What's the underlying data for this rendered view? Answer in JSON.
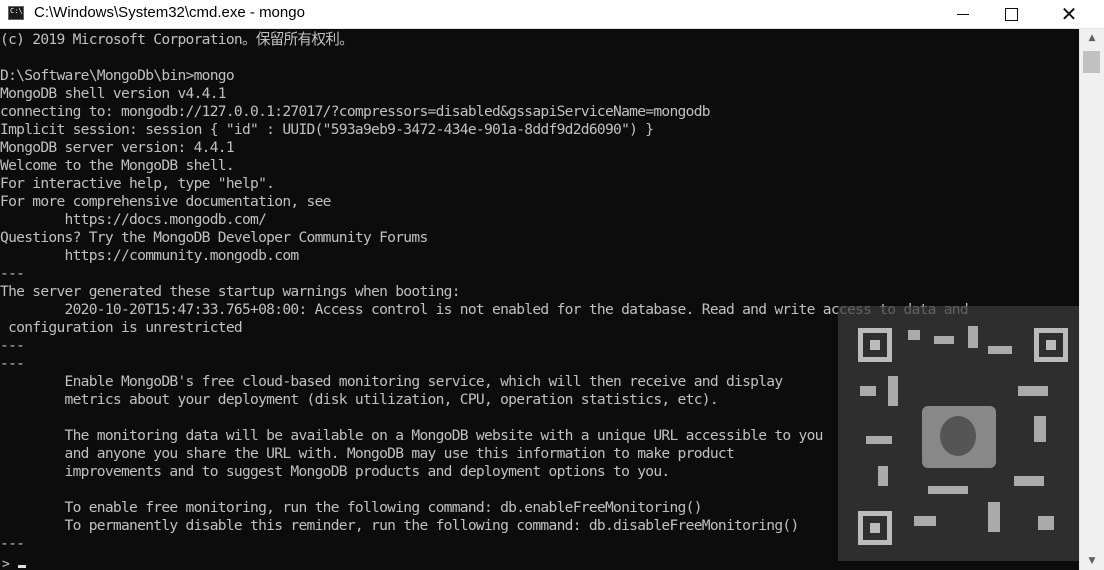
{
  "window": {
    "title": "C:\\Windows\\System32\\cmd.exe - mongo",
    "icons": {
      "app": "cmd-icon",
      "minimize": "minimize-icon",
      "maximize": "maximize-icon",
      "close": "close-icon"
    },
    "close_glyph": "✕"
  },
  "console": {
    "lines": [
      "(c) 2019 Microsoft Corporation。保留所有权利。",
      "",
      "D:\\Software\\MongoDb\\bin>mongo",
      "MongoDB shell version v4.4.1",
      "connecting to: mongodb://127.0.0.1:27017/?compressors=disabled&gssapiServiceName=mongodb",
      "Implicit session: session { \"id\" : UUID(\"593a9eb9-3472-434e-901a-8ddf9d2d6090\") }",
      "MongoDB server version: 4.4.1",
      "Welcome to the MongoDB shell.",
      "For interactive help, type \"help\".",
      "For more comprehensive documentation, see",
      "        https://docs.mongodb.com/",
      "Questions? Try the MongoDB Developer Community Forums",
      "        https://community.mongodb.com",
      "---",
      "The server generated these startup warnings when booting:",
      "        2020-10-20T15:47:33.765+08:00: Access control is not enabled for the database. Read and write access to data and",
      " configuration is unrestricted",
      "---",
      "---",
      "        Enable MongoDB's free cloud-based monitoring service, which will then receive and display",
      "        metrics about your deployment (disk utilization, CPU, operation statistics, etc).",
      "",
      "        The monitoring data will be available on a MongoDB website with a unique URL accessible to you",
      "        and anyone you share the URL with. MongoDB may use this information to make product",
      "        improvements and to suggest MongoDB products and deployment options to you.",
      "",
      "        To enable free monitoring, run the following command: db.enableFreeMonitoring()",
      "        To permanently disable this reminder, run the following command: db.disableFreeMonitoring()",
      "---"
    ],
    "prompt": ">"
  },
  "scrollbar": {
    "up": "▲",
    "down": "▼"
  },
  "colors": {
    "background": "#0c0c0c",
    "text": "#c0c0c0",
    "titlebar": "#ffffff"
  }
}
